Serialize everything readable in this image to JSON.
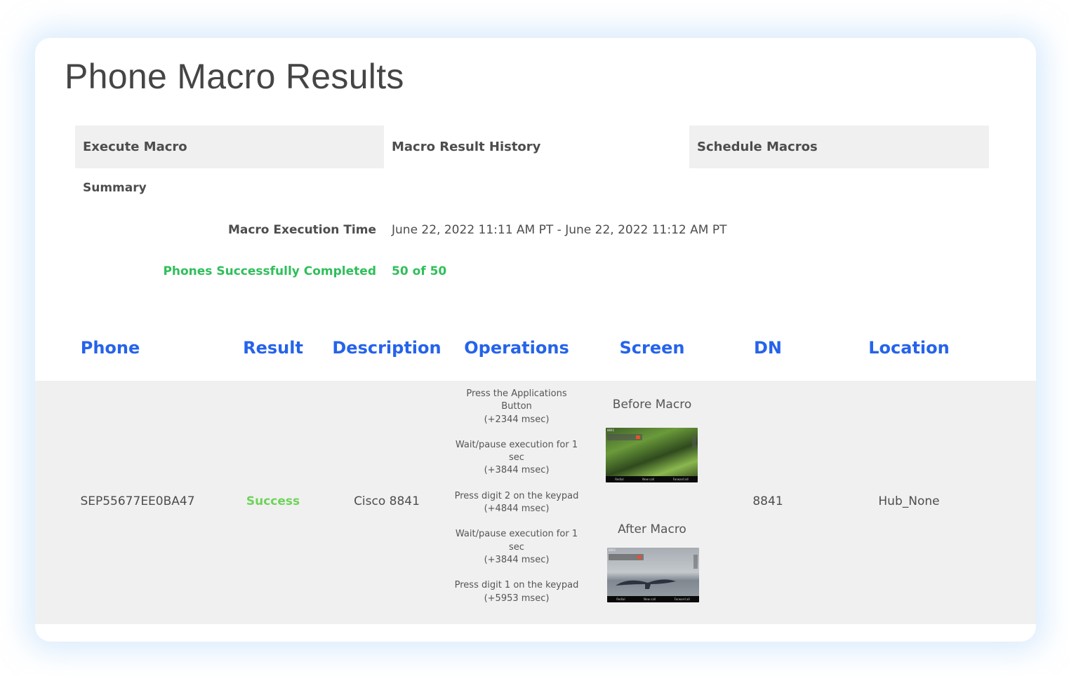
{
  "page": {
    "title": "Phone Macro Results"
  },
  "tabs": [
    {
      "label": "Execute Macro"
    },
    {
      "label": "Macro Result History"
    },
    {
      "label": "Schedule Macros"
    }
  ],
  "summary": {
    "heading": "Summary",
    "execution_time_label": "Macro Execution Time",
    "execution_time_value": "June 22, 2022 11:11 AM PT - June 22, 2022 11:12 AM PT",
    "completed_label": "Phones Successfully Completed",
    "completed_value": "50 of 50"
  },
  "colors": {
    "header_blue": "#2563eb",
    "success_green": "#2fbf5a",
    "result_green": "#6fd35a"
  },
  "table": {
    "columns": [
      "Phone",
      "Result",
      "Description",
      "Operations",
      "Screen",
      "DN",
      "Location"
    ],
    "rows": [
      {
        "phone": "SEP55677EE0BA47",
        "result": "Success",
        "description": "Cisco 8841",
        "operations": [
          {
            "text": "Press the Applications Button",
            "time": "(+2344 msec)"
          },
          {
            "text": "Wait/pause execution for 1 sec",
            "time": "(+3844 msec)"
          },
          {
            "text": "Press digit 2 on the keypad",
            "time": "(+4844 msec)"
          },
          {
            "text": "Wait/pause execution for 1 sec",
            "time": "(+3844 msec)"
          },
          {
            "text": "Press digit 1 on the keypad",
            "time": "(+5953 msec)"
          }
        ],
        "screen": {
          "before_label": "Before Macro",
          "after_label": "After Macro",
          "phone_line": "8841",
          "softkeys": [
            "Redial",
            "New call",
            "Forward all"
          ]
        },
        "dn": "8841",
        "location": "Hub_None"
      }
    ]
  }
}
